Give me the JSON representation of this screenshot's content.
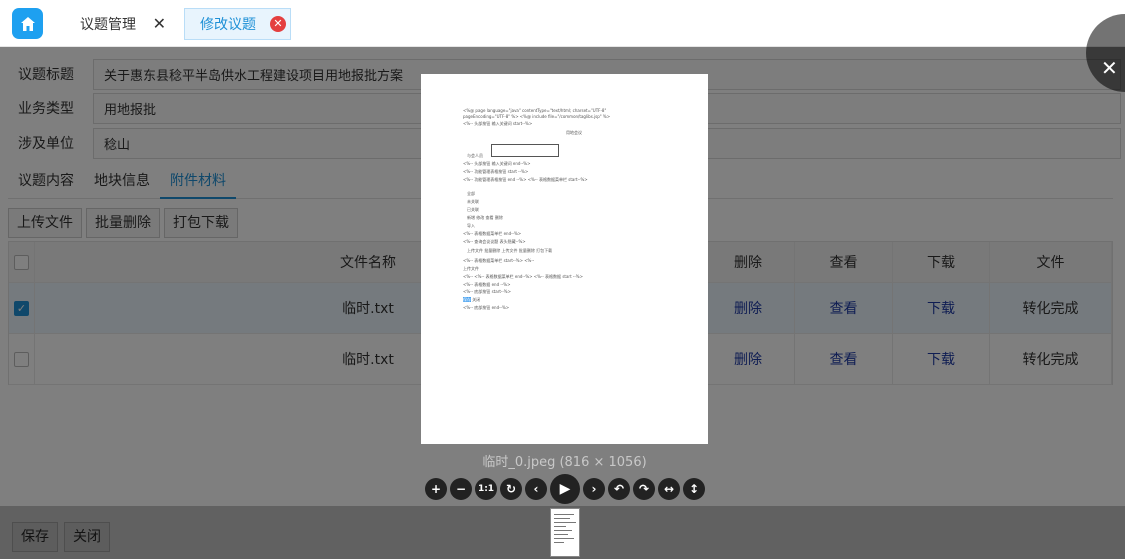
{
  "tabs": [
    {
      "label": "议题管理",
      "close": "✕"
    },
    {
      "label": "修改议题",
      "close": "✕"
    }
  ],
  "form": {
    "fields": [
      {
        "label": "议题标题",
        "value": "关于惠东县稔平半岛供水工程建设项目用地报批方案"
      },
      {
        "label": "业务类型",
        "value": "用地报批"
      },
      {
        "label": "涉及单位",
        "value": "稔山"
      }
    ]
  },
  "subtabs": [
    "议题内容",
    "地块信息",
    "附件材料"
  ],
  "toolbar": {
    "upload": "上传文件",
    "batch_delete": "批量删除",
    "pack_download": "打包下载"
  },
  "table": {
    "headers": {
      "name": "文件名称",
      "delete": "删除",
      "view": "查看",
      "download": "下载",
      "file": "文件"
    },
    "rows": [
      {
        "checked": true,
        "name": "临时.txt",
        "delete": "删除",
        "view": "查看",
        "download": "下载",
        "file": "转化完成"
      },
      {
        "checked": false,
        "name": "临时.txt",
        "delete": "删除",
        "view": "查看",
        "download": "下载",
        "file": "转化完成"
      }
    ]
  },
  "footer": {
    "save": "保存",
    "close": "关闭"
  },
  "viewer": {
    "caption": "临时_0.jpeg (816 × 1056)",
    "close_glyph": "✕",
    "doc_lines": [
      "<%@ page language=\"java\"    contentType=\"text/html;     charset=\"UTF-8\"",
      "pageEncoding=\"UTF-8\"   %>  <%@ include  file=\"/common/taglibs.jsp\"   %>",
      "<%-- 头部按钮 输入关键词 start--%>",
      "用地会议",
      "与会人员",
      "<%-- 头部按钮 输入关键词 end--%>",
      "<%-- 功能管理表格按钮 start --%>",
      "<%-- 功能管理表格按钮 end --%> <%-- 表格数据菜单栏 start--%>",
      "全部",
      "未关联",
      "已关联",
      "新增  修改  查看  删除",
      "导入",
      "<%-- 表格数据菜单栏 end--%>",
      "<%-- 查询会议议题 表头隐藏--%>",
      "上传文件  批量删除  上传文件  批量删除  打包下载",
      "<%-- 表格数据菜单栏 start--%> <%--",
      "上传文件",
      "<%-- <%-- 表格数据菜单栏 end--%> <%-- 表格数据 start --%>",
      "<%-- 表格数据 end --%>",
      "<%-- 底部按钮 start--%>",
      "保存",
      "关闭",
      "<%-- 底部按钮 end--%>"
    ]
  },
  "colors": {
    "accent": "#1e90d6",
    "link": "#1e3aa6",
    "close_badge": "#e43f3f",
    "home": "#1ea0f0"
  }
}
